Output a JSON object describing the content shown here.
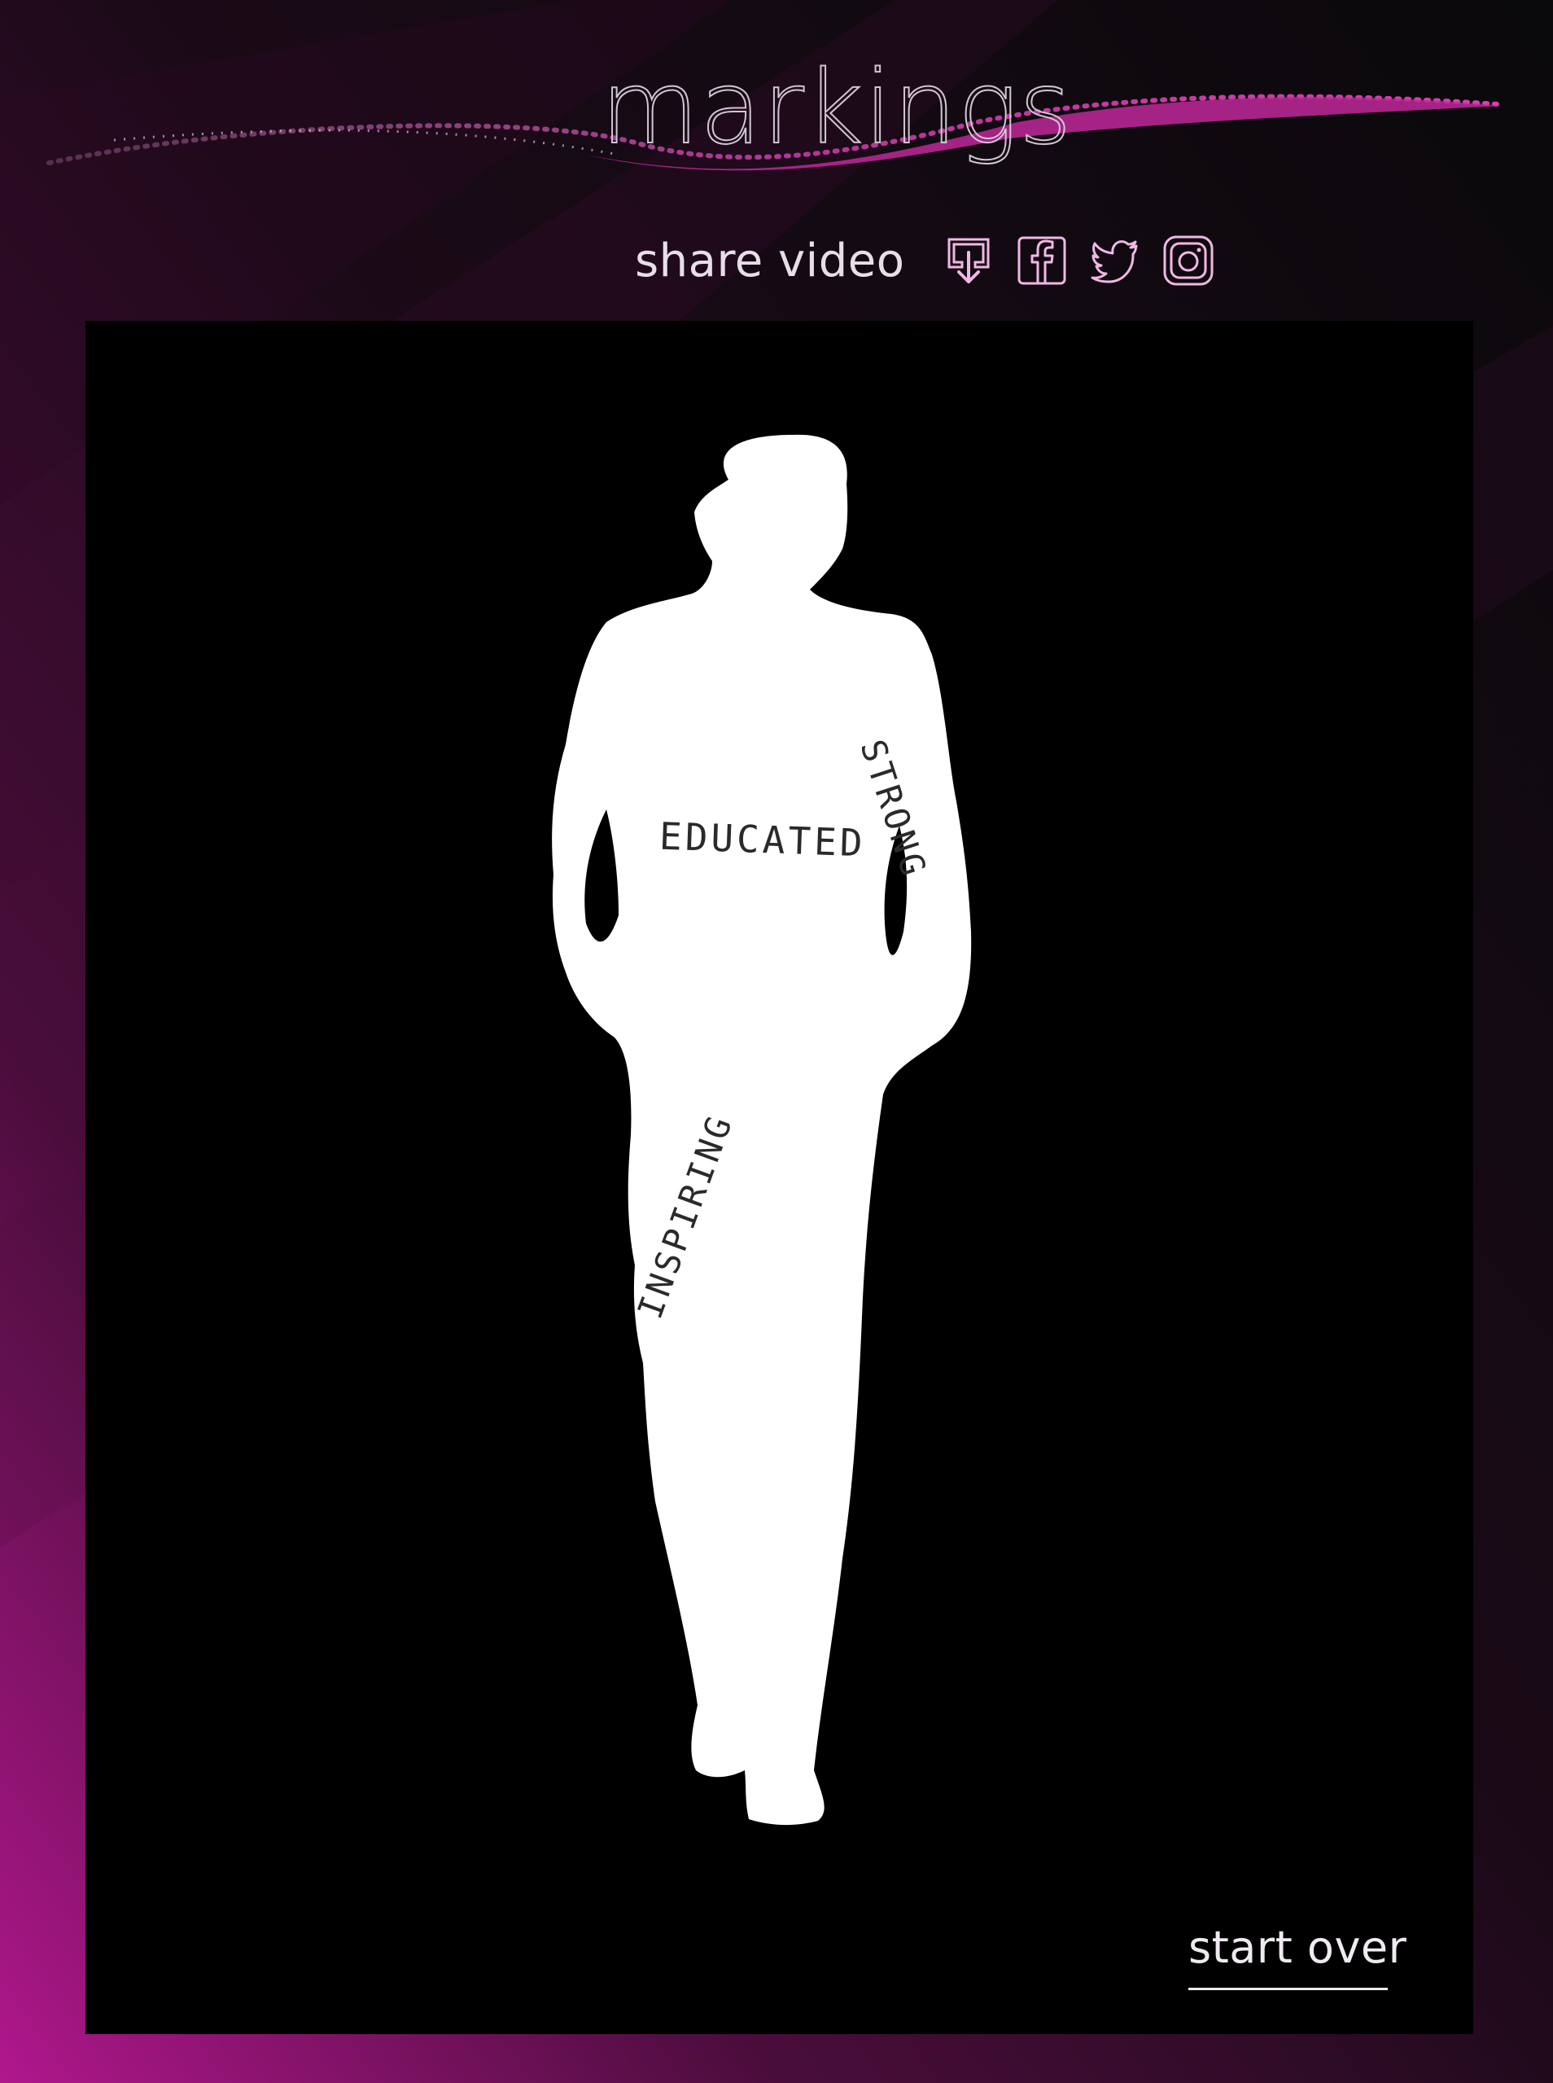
{
  "app": {
    "logo_text": "markings"
  },
  "share": {
    "label": "share video",
    "icons": [
      "download-icon",
      "facebook-icon",
      "twitter-icon",
      "instagram-icon"
    ]
  },
  "video": {
    "words": [
      "EDUCATED",
      "STRONG",
      "INSPIRING"
    ]
  },
  "actions": {
    "start_over": "start over"
  },
  "colors": {
    "accent": "#b4268f",
    "accent_dark": "#3a0c2c",
    "background": "#08070a",
    "icon_stroke": "#f0b8e4",
    "text": "#e6dfe8"
  }
}
